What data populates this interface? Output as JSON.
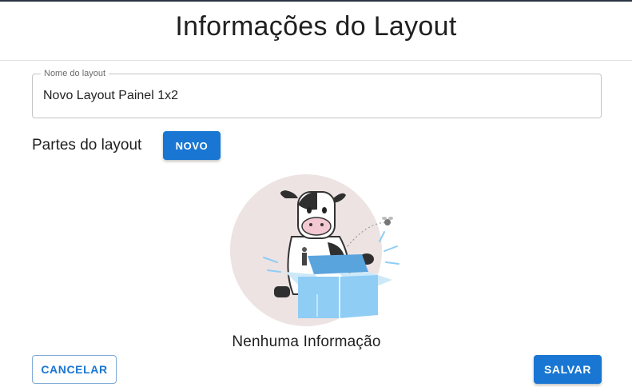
{
  "dialog": {
    "title": "Informações do Layout"
  },
  "name_field": {
    "label": "Nome do layout",
    "value": "Novo Layout Painel 1x2"
  },
  "parts": {
    "title": "Partes do layout",
    "new_button": "NOVO"
  },
  "empty_state": {
    "illustration": "cow-with-open-box",
    "message": "Nenhuma Informação"
  },
  "footer": {
    "cancel_label": "CANCELAR",
    "save_label": "SALVAR"
  },
  "colors": {
    "primary": "#1976d2",
    "illustration_circle": "#ede3e3",
    "box_blue": "#8fcdf5"
  }
}
